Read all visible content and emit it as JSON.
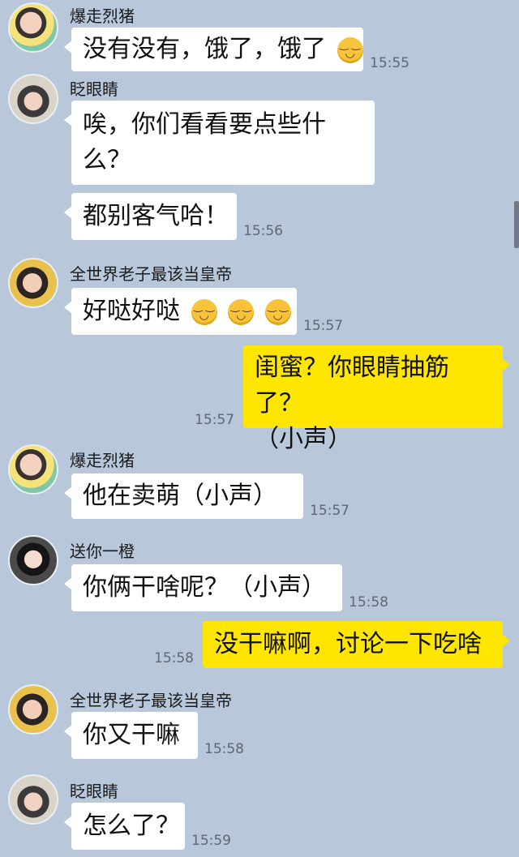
{
  "messages": [
    {
      "sender": "爆走烈猪",
      "text": "没有没有，饿了，饿了",
      "emoji": "smile-emoji",
      "time": "15:55"
    },
    {
      "sender": "眨眼睛",
      "text_line1": "唉，你们看看要点些什",
      "text_line2": "么？"
    },
    {
      "text": "都别客气哈！",
      "time": "15:56"
    },
    {
      "sender": "全世界老子最该当皇帝",
      "text": "好哒好哒",
      "emoji": "wink-emoji",
      "time": "15:57"
    },
    {
      "self": true,
      "text_line1": "闺蜜？你眼睛抽筋了？",
      "text_line2": "（小声）",
      "time": "15:57"
    },
    {
      "sender": "爆走烈猪",
      "text": "他在卖萌（小声）",
      "time": "15:57"
    },
    {
      "sender": "送你一橙",
      "text": "你俩干啥呢？（小声）",
      "time": "15:58"
    },
    {
      "self": true,
      "text": "没干嘛啊，讨论一下吃啥",
      "time": "15:58"
    },
    {
      "sender": "全世界老子最该当皇帝",
      "text": "你又干嘛",
      "time": "15:58"
    },
    {
      "sender": "眨眼睛",
      "text": "怎么了？",
      "time": "15:59"
    }
  ],
  "colors": {
    "background": "#b8c8da",
    "self_bubble": "#ffe600",
    "other_bubble": "#ffffff"
  }
}
